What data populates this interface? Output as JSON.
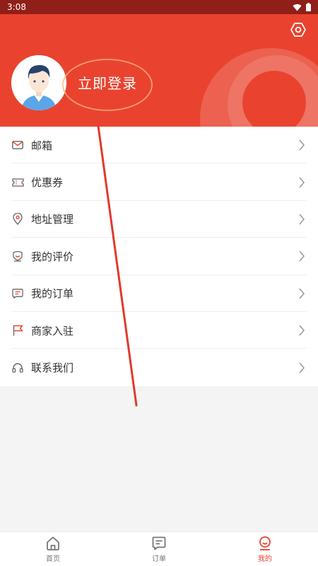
{
  "status_bar": {
    "time": "3:08"
  },
  "header": {
    "login_label": "立即登录"
  },
  "menu": {
    "items": [
      {
        "label": "邮箱",
        "icon": "mail-icon"
      },
      {
        "label": "优惠券",
        "icon": "coupon-icon"
      },
      {
        "label": "地址管理",
        "icon": "location-pin-icon"
      },
      {
        "label": "我的评价",
        "icon": "review-icon"
      },
      {
        "label": "我的订单",
        "icon": "order-icon"
      },
      {
        "label": "商家入驻",
        "icon": "flag-icon"
      },
      {
        "label": "联系我们",
        "icon": "headset-icon"
      }
    ]
  },
  "bottom_nav": {
    "items": [
      {
        "label": "首页",
        "icon": "home-icon"
      },
      {
        "label": "订单",
        "icon": "order-icon"
      },
      {
        "label": "我的",
        "icon": "profile-icon"
      }
    ],
    "active": "我的"
  },
  "colors": {
    "accent": "#e9432f",
    "status_bar": "#8f1f18",
    "icon_gray": "#666666"
  }
}
